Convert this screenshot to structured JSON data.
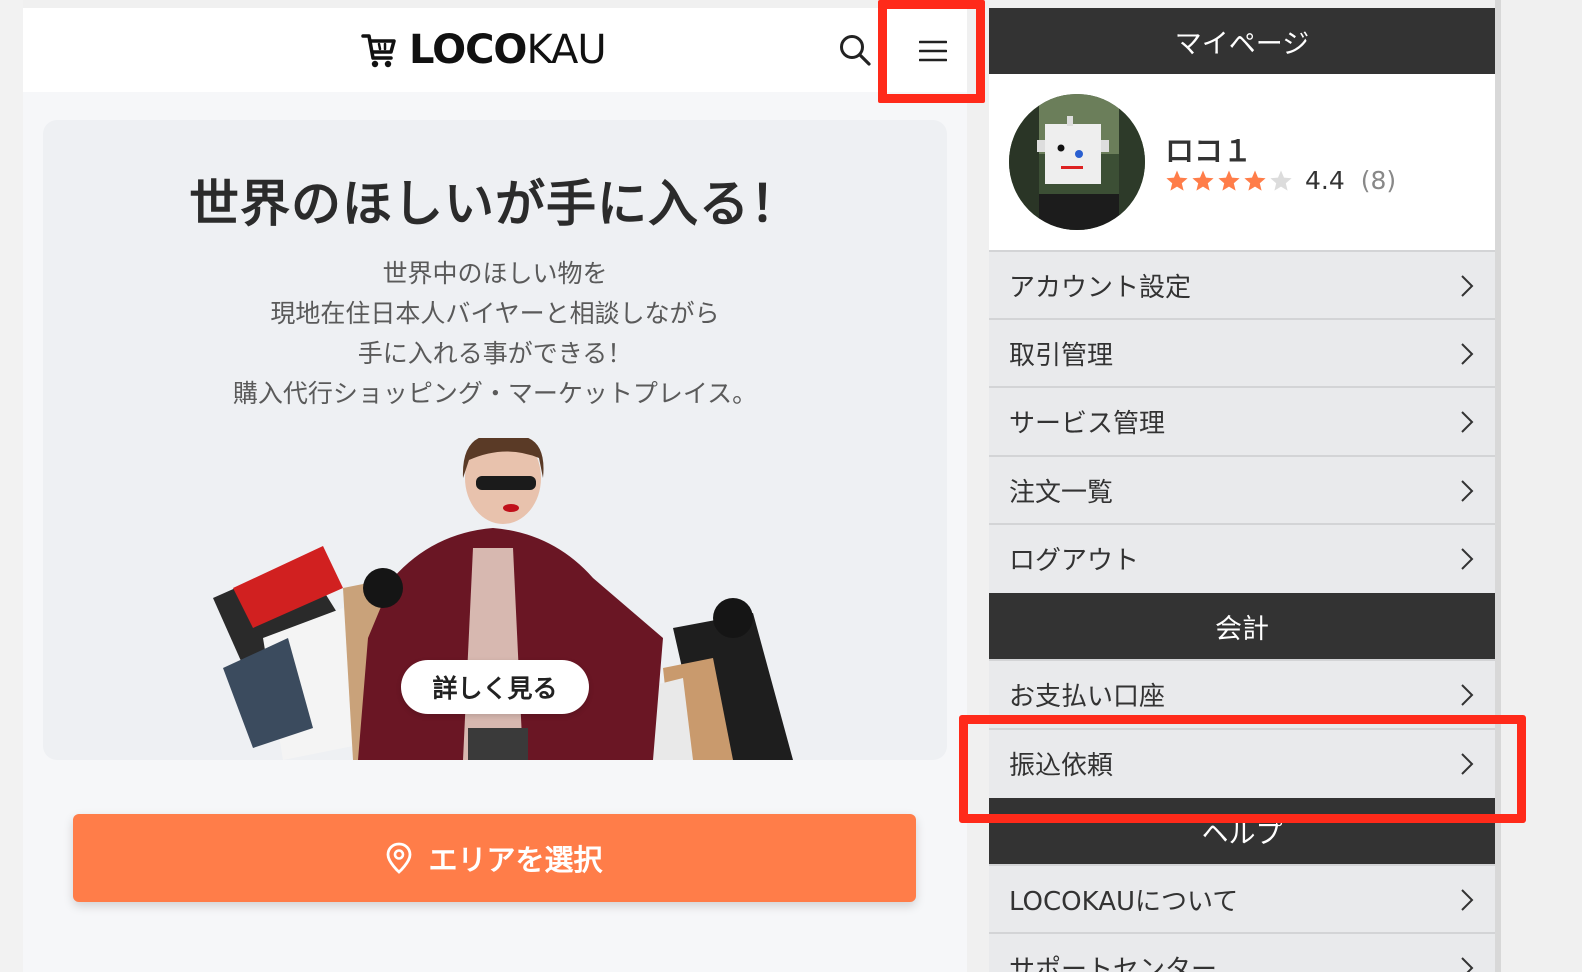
{
  "header": {
    "logo_bold": "LOCO",
    "logo_light": "KAU"
  },
  "hero": {
    "title": "世界のほしいが手に入る！",
    "description": [
      "世界中のほしい物を",
      "現地在住日本人バイヤーと相談しながら",
      "手に入れる事ができる！",
      "購入代行ショッピング・マーケットプレイス。"
    ],
    "detail_button": "詳しく見る"
  },
  "area_button": {
    "label": "エリアを選択"
  },
  "drawer": {
    "mypage_title": "マイページ",
    "profile": {
      "name": "ロコ１",
      "rating": "4.4",
      "review_count": "(8)",
      "stars_filled": 4,
      "stars_total": 5
    },
    "mypage_items": [
      {
        "label": "アカウント設定"
      },
      {
        "label": "取引管理"
      },
      {
        "label": "サービス管理"
      },
      {
        "label": "注文一覧"
      },
      {
        "label": "ログアウト"
      }
    ],
    "accounting_title": "会計",
    "accounting_items": [
      {
        "label": "お支払い口座"
      },
      {
        "label": "振込依頼"
      }
    ],
    "help_title": "ヘルプ",
    "help_items": [
      {
        "label": "LOCOKAUについて"
      },
      {
        "label": "サポートセンター"
      }
    ]
  },
  "colors": {
    "accent_orange": "#ff7d49",
    "star": "#ff7d49",
    "highlight": "#ff2a1a",
    "section_dark": "#333333"
  }
}
